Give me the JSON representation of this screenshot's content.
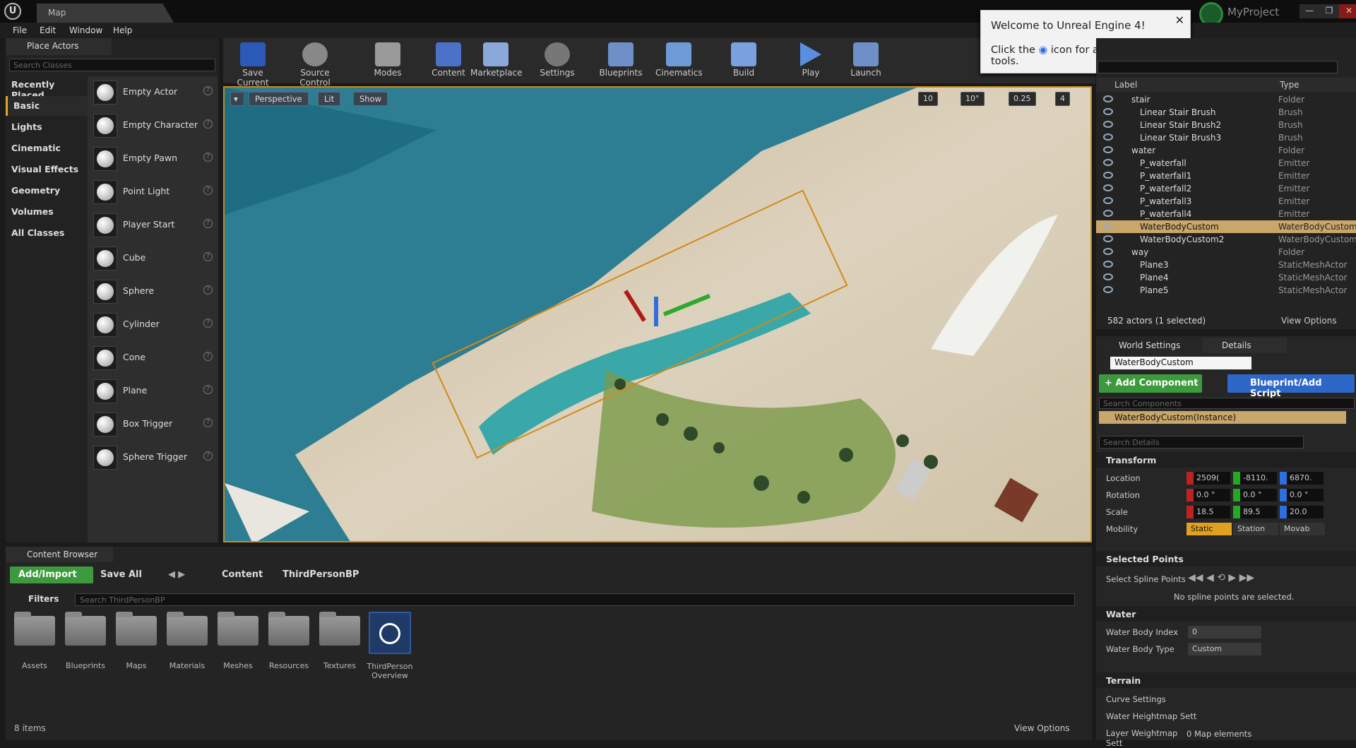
{
  "window": {
    "tab": "Map",
    "project": "MyProject",
    "min": "—",
    "max": "❐",
    "close": "✕"
  },
  "menu": [
    "File",
    "Edit",
    "Window",
    "Help"
  ],
  "place_actors": {
    "tab": "Place Actors",
    "search_placeholder": "Search Classes",
    "categories": [
      "Recently Placed",
      "Basic",
      "Lights",
      "Cinematic",
      "Visual Effects",
      "Geometry",
      "Volumes",
      "All Classes"
    ],
    "actors": [
      "Empty Actor",
      "Empty Character",
      "Empty Pawn",
      "Point Light",
      "Player Start",
      "Cube",
      "Sphere",
      "Cylinder",
      "Cone",
      "Plane",
      "Box Trigger",
      "Sphere Trigger"
    ]
  },
  "toolbar": [
    "Save Current",
    "Source Control",
    "Modes",
    "Content",
    "Marketplace",
    "Settings",
    "Blueprints",
    "Cinematics",
    "Build",
    "Play",
    "Launch"
  ],
  "viewport": {
    "perspective": "Perspective",
    "lit": "Lit",
    "show": "Show",
    "grid": "10",
    "angle": "10°",
    "scale": "0.25",
    "speed": "4"
  },
  "welcome": {
    "title": "Welcome to Unreal Engine 4!",
    "body_pre": "Click the",
    "body_post": "icon for a tour of the tools."
  },
  "outliner": {
    "col_label": "Label",
    "col_type": "Type",
    "rows": [
      {
        "name": "stair",
        "type": "Folder",
        "indent": 2
      },
      {
        "name": "Linear Stair Brush",
        "type": "Brush",
        "indent": 3
      },
      {
        "name": "Linear Stair Brush2",
        "type": "Brush",
        "indent": 3
      },
      {
        "name": "Linear Stair Brush3",
        "type": "Brush",
        "indent": 3
      },
      {
        "name": "water",
        "type": "Folder",
        "indent": 2
      },
      {
        "name": "P_waterfall",
        "type": "Emitter",
        "indent": 3
      },
      {
        "name": "P_waterfall1",
        "type": "Emitter",
        "indent": 3
      },
      {
        "name": "P_waterfall2",
        "type": "Emitter",
        "indent": 3
      },
      {
        "name": "P_waterfall3",
        "type": "Emitter",
        "indent": 3
      },
      {
        "name": "P_waterfall4",
        "type": "Emitter",
        "indent": 3
      },
      {
        "name": "WaterBodyCustom",
        "type": "WaterBodyCustom",
        "indent": 3
      },
      {
        "name": "WaterBodyCustom2",
        "type": "WaterBodyCustom",
        "indent": 3
      },
      {
        "name": "way",
        "type": "Folder",
        "indent": 2
      },
      {
        "name": "Plane3",
        "type": "StaticMeshActor",
        "indent": 3
      },
      {
        "name": "Plane4",
        "type": "StaticMeshActor",
        "indent": 3
      },
      {
        "name": "Plane5",
        "type": "StaticMeshActor",
        "indent": 3
      }
    ],
    "count": "582 actors (1 selected)",
    "view_options": "View Options"
  },
  "details": {
    "tabs": [
      "World Settings",
      "Details"
    ],
    "name": "WaterBodyCustom",
    "add_component": "+ Add Component",
    "blueprint": "Blueprint/Add Script",
    "search_components": "Search Components",
    "component_row": "WaterBodyCustom(Instance)",
    "search_details": "Search Details",
    "transform": "Transform",
    "location": {
      "label": "Location",
      "x": "2509(",
      "y": "-8110.",
      "z": "6870."
    },
    "rotation": {
      "label": "Rotation",
      "x": "0.0 °",
      "y": "0.0 °",
      "z": "0.0 °"
    },
    "scale": {
      "label": "Scale",
      "x": "18.5",
      "y": "89.5",
      "z": "20.0"
    },
    "mobility": {
      "label": "Mobility",
      "static": "Static",
      "stationary": "Station",
      "movable": "Movab"
    },
    "selected_points": "Selected Points",
    "select_spline": "Select Spline Points",
    "no_spline": "No spline points are selected.",
    "water": "Water",
    "water_index_label": "Water Body Index",
    "water_index": "0",
    "water_type_label": "Water Body Type",
    "water_type": "Custom",
    "terrain": "Terrain",
    "curve_settings": "Curve Settings",
    "heightmap": "Water Heightmap Sett",
    "weightmap": "Layer Weightmap Sett",
    "weightmap_val": "0 Map elements"
  },
  "content_browser": {
    "tab": "Content Browser",
    "add_import": "Add/Import",
    "save_all": "Save All",
    "crumbs": [
      "Content",
      "ThirdPersonBP"
    ],
    "filters": "Filters",
    "search_placeholder": "Search ThirdPersonBP",
    "folders": [
      "Assets",
      "Blueprints",
      "Maps",
      "Materials",
      "Meshes",
      "Resources",
      "Textures"
    ],
    "asset": "ThirdPerson Overview",
    "count": "8 items",
    "view_options": "View Options"
  }
}
